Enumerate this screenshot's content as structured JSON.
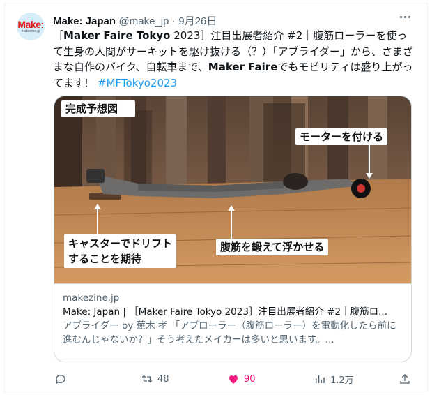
{
  "tweet": {
    "display_name": "Make: Japan",
    "handle": "@make_jp",
    "date": "9月26日",
    "avatar_logo": "Make:",
    "avatar_sub": "makezine.jp",
    "text": {
      "p1": "［",
      "maker_faire_tokyo": "Maker Faire Tokyo",
      "p2": " 2023］注目出展者紹介 #2｜腹筋ローラーを使って生身の人間がサーキットを駆け抜ける（？）「アブライダー」から、さまざまな自作のバイク、自転車まで、",
      "maker_faire": "Maker Faire",
      "p3": "でもモビリティは盛り上がってます！ ",
      "hashtag": "#MFTokyo2023"
    }
  },
  "card": {
    "image_labels": {
      "top_left": "完成予想図",
      "right": "モーターを付ける",
      "bottom_left_line1": "キャスターでドリフト",
      "bottom_left_line2": "することを期待",
      "bottom_center": "腹筋を鍛えて浮かせる"
    },
    "domain": "makezine.jp",
    "title": "Make: Japan | ［Maker Faire Tokyo 2023］注目出展者紹介 #2｜腹筋ロ...",
    "description": "アブライダー by 蕪木 孝 「アブローラー（腹筋ローラー）を電動化したら前に進むんじゃないか？」そう考えたメイカーは多いと思います。..."
  },
  "actions": {
    "reply_count": "",
    "retweet_count": "48",
    "like_count": "90",
    "views_count": "1.2万"
  },
  "colors": {
    "accent": "#1d9bf0",
    "like": "#f91880",
    "muted": "#536471"
  },
  "icons": [
    "more-icon",
    "reply-icon",
    "retweet-icon",
    "like-icon",
    "views-icon",
    "share-icon"
  ]
}
